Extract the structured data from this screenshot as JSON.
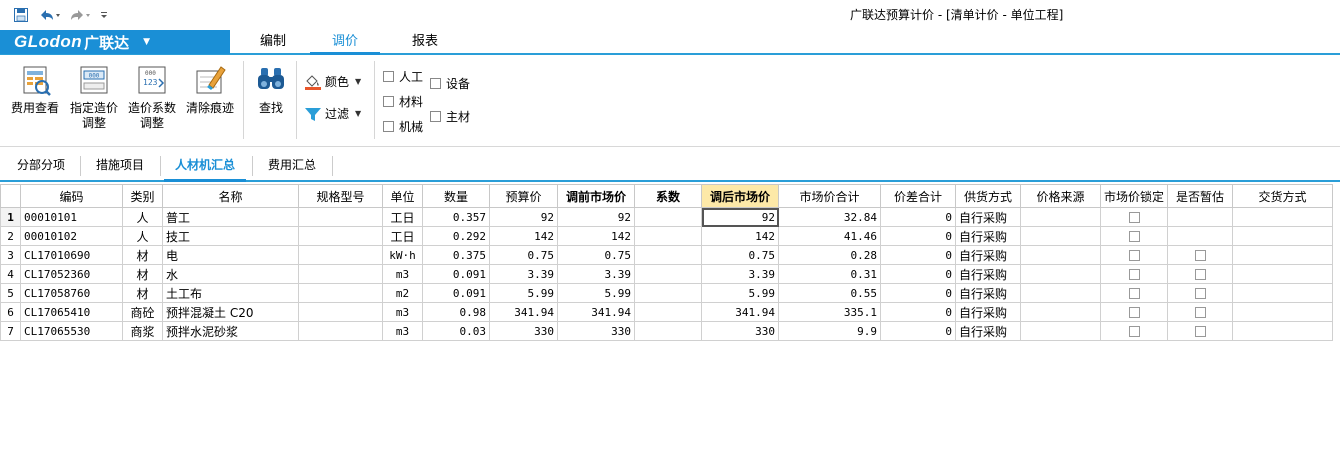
{
  "app_title": "广联达预算计价 - [清单计价 - 单位工程]",
  "logo": {
    "brand": "GLodon",
    "name": "广联达"
  },
  "menu_tabs": [
    "编制",
    "调价",
    "报表"
  ],
  "ribbon": {
    "fee_view": [
      "费用查看"
    ],
    "specify_price": [
      "指定造价",
      "调整"
    ],
    "cost_coefficient": [
      "造价系数",
      "调整"
    ],
    "clear_trace": [
      "清除痕迹"
    ],
    "find": [
      "查找"
    ],
    "color": "颜色",
    "filter": "过滤",
    "filters": {
      "labor": "人工",
      "material": "材料",
      "machine": "机械",
      "equipment": "设备",
      "main_material": "主材"
    }
  },
  "sub_tabs": [
    "分部分项",
    "措施项目",
    "人材机汇总",
    "费用汇总"
  ],
  "grid": {
    "headers": [
      "编码",
      "类别",
      "名称",
      "规格型号",
      "单位",
      "数量",
      "预算价",
      "调前市场价",
      "系数",
      "调后市场价",
      "市场价合计",
      "价差合计",
      "供货方式",
      "价格来源",
      "市场价锁定",
      "是否暂估",
      "交货方式"
    ],
    "rows": [
      {
        "no": "1",
        "code": "00010101",
        "type": "人",
        "name": "普工",
        "spec": "",
        "unit": "工日",
        "qty": "0.357",
        "budget": "92",
        "pre": "92",
        "coef": "",
        "post": "92",
        "total": "32.84",
        "diff": "0",
        "supply": "自行采购",
        "source": "",
        "lock": true,
        "temp": false
      },
      {
        "no": "2",
        "code": "00010102",
        "type": "人",
        "name": "技工",
        "spec": "",
        "unit": "工日",
        "qty": "0.292",
        "budget": "142",
        "pre": "142",
        "coef": "",
        "post": "142",
        "total": "41.46",
        "diff": "0",
        "supply": "自行采购",
        "source": "",
        "lock": true,
        "temp": false
      },
      {
        "no": "3",
        "code": "CL17010690",
        "type": "材",
        "name": "电",
        "spec": "",
        "unit": "kW·h",
        "qty": "0.375",
        "budget": "0.75",
        "pre": "0.75",
        "coef": "",
        "post": "0.75",
        "total": "0.28",
        "diff": "0",
        "supply": "自行采购",
        "source": "",
        "lock": true,
        "temp": true
      },
      {
        "no": "4",
        "code": "CL17052360",
        "type": "材",
        "name": "水",
        "spec": "",
        "unit": "m3",
        "qty": "0.091",
        "budget": "3.39",
        "pre": "3.39",
        "coef": "",
        "post": "3.39",
        "total": "0.31",
        "diff": "0",
        "supply": "自行采购",
        "source": "",
        "lock": true,
        "temp": true
      },
      {
        "no": "5",
        "code": "CL17058760",
        "type": "材",
        "name": "土工布",
        "spec": "",
        "unit": "m2",
        "qty": "0.091",
        "budget": "5.99",
        "pre": "5.99",
        "coef": "",
        "post": "5.99",
        "total": "0.55",
        "diff": "0",
        "supply": "自行采购",
        "source": "",
        "lock": true,
        "temp": true
      },
      {
        "no": "6",
        "code": "CL17065410",
        "type": "商砼",
        "name": "预拌混凝土 C20",
        "spec": "",
        "unit": "m3",
        "qty": "0.98",
        "budget": "341.94",
        "pre": "341.94",
        "coef": "",
        "post": "341.94",
        "total": "335.1",
        "diff": "0",
        "supply": "自行采购",
        "source": "",
        "lock": true,
        "temp": true
      },
      {
        "no": "7",
        "code": "CL17065530",
        "type": "商浆",
        "name": "预拌水泥砂浆",
        "spec": "",
        "unit": "m3",
        "qty": "0.03",
        "budget": "330",
        "pre": "330",
        "coef": "",
        "post": "330",
        "total": "9.9",
        "diff": "0",
        "supply": "自行采购",
        "source": "",
        "lock": true,
        "temp": true
      }
    ]
  },
  "colors": {
    "accent": "#1a8fd6",
    "header_highlight": "#fde9a8"
  }
}
